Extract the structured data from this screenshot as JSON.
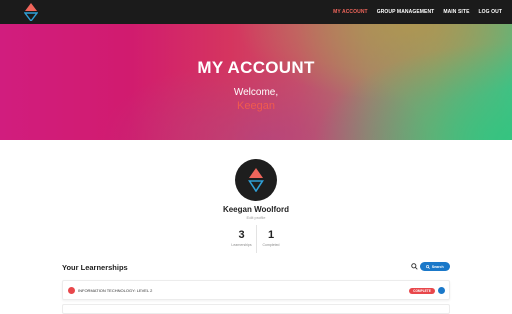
{
  "nav": {
    "links": [
      "MY ACCOUNT",
      "GROUP MANAGEMENT",
      "MAIN SITE",
      "LOG OUT"
    ],
    "active_color": "#f0655b"
  },
  "hero": {
    "title": "MY ACCOUNT",
    "welcome": "Welcome,",
    "name": "Keegan"
  },
  "profile": {
    "name": "Keegan Woolford",
    "edit_label": "Edit profile"
  },
  "stats": [
    {
      "value": "3",
      "label": "Learnerships"
    },
    {
      "value": "1",
      "label": "Completed"
    }
  ],
  "learnerships": {
    "title": "Your Learnerships",
    "search_button": "Search",
    "items": [
      {
        "title": "INFORMATION TECHNOLOGY: LEVEL 2",
        "badge": "COMPLETE"
      }
    ]
  },
  "colors": {
    "brand_red": "#e8474b",
    "brand_blue": "#1a78c9",
    "navbar": "#1b1b1b"
  }
}
